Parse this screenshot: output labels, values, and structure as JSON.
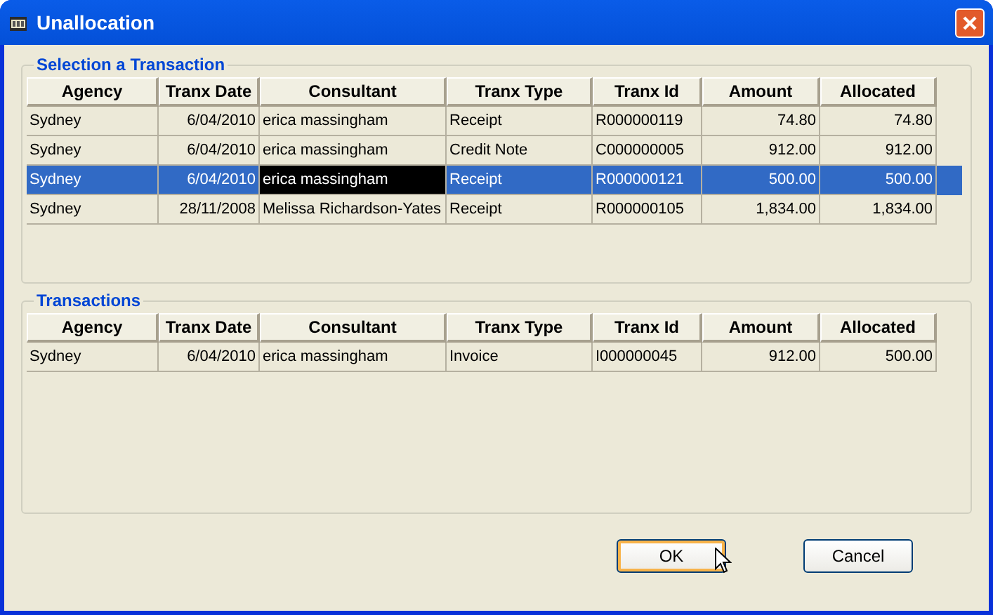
{
  "window": {
    "title": "Unallocation"
  },
  "selection_group": {
    "title": "Selection a Transaction",
    "columns": [
      "Agency",
      "Tranx Date",
      "Consultant",
      "Tranx Type",
      "Tranx Id",
      "Amount",
      "Allocated"
    ],
    "rows": [
      {
        "selected": false,
        "focused": false,
        "cells": [
          "Sydney",
          "6/04/2010",
          "erica massingham",
          "Receipt",
          "R000000119",
          "74.80",
          "74.80"
        ]
      },
      {
        "selected": false,
        "focused": false,
        "cells": [
          "Sydney",
          "6/04/2010",
          "erica massingham",
          "Credit Note",
          "C000000005",
          "912.00",
          "912.00"
        ]
      },
      {
        "selected": true,
        "focused": true,
        "cells": [
          "Sydney",
          "6/04/2010",
          "erica massingham",
          "Receipt",
          "R000000121",
          "500.00",
          "500.00"
        ]
      },
      {
        "selected": false,
        "focused": false,
        "cells": [
          "Sydney",
          "28/11/2008",
          "Melissa Richardson-Yates",
          "Receipt",
          "R000000105",
          "1,834.00",
          "1,834.00"
        ]
      }
    ]
  },
  "transactions_group": {
    "title": "Transactions",
    "columns": [
      "Agency",
      "Tranx Date",
      "Consultant",
      "Tranx Type",
      "Tranx Id",
      "Amount",
      "Allocated"
    ],
    "rows": [
      {
        "selected": false,
        "focused": false,
        "cells": [
          "Sydney",
          "6/04/2010",
          "erica massingham",
          "Invoice",
          "I000000045",
          "912.00",
          "500.00"
        ]
      }
    ]
  },
  "buttons": [
    {
      "label": "OK",
      "default": true
    },
    {
      "label": "Cancel",
      "default": false
    }
  ]
}
